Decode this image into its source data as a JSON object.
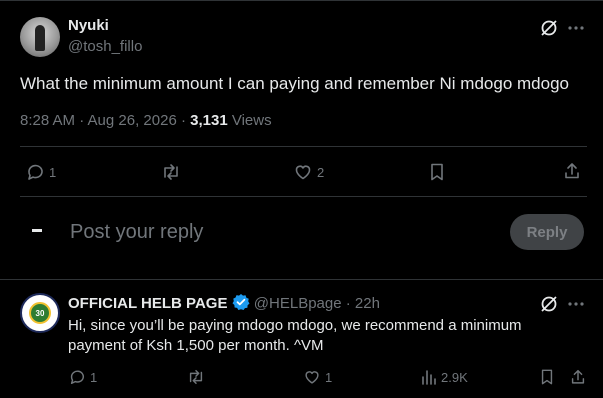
{
  "tweet": {
    "author_name": "Nyuki",
    "author_handle": "@tosh_fillo",
    "text": "What the minimum amount I can paying and remember Ni mdogo mdogo",
    "meta_time": "8:28 AM · Aug 26, 2026 · ",
    "views_count": "3,131",
    "views_label": " Views",
    "replies": "1",
    "likes": "2"
  },
  "composer": {
    "placeholder": "Post your reply",
    "reply_button": "Reply",
    "avatar_glyph": "▬"
  },
  "reply": {
    "author_name": "OFFICIAL HELB PAGE",
    "author_handle": "@HELBpage",
    "time": "· 22h",
    "text": "Hi, since you’ll be paying mdogo mdogo, we recommend a minimum payment of Ksh 1,500 per month. ^VM",
    "replies": "1",
    "likes": "1",
    "views": "2.9K",
    "logo_number": "30"
  },
  "colors": {
    "accent": "#1d9bf0",
    "muted": "#71767b",
    "text": "#e7e9ea"
  },
  "icons": [
    "grok-icon",
    "more-icon",
    "reply-icon",
    "repost-icon",
    "like-icon",
    "bookmark-icon",
    "share-icon",
    "views-icon",
    "verified-badge-icon"
  ]
}
